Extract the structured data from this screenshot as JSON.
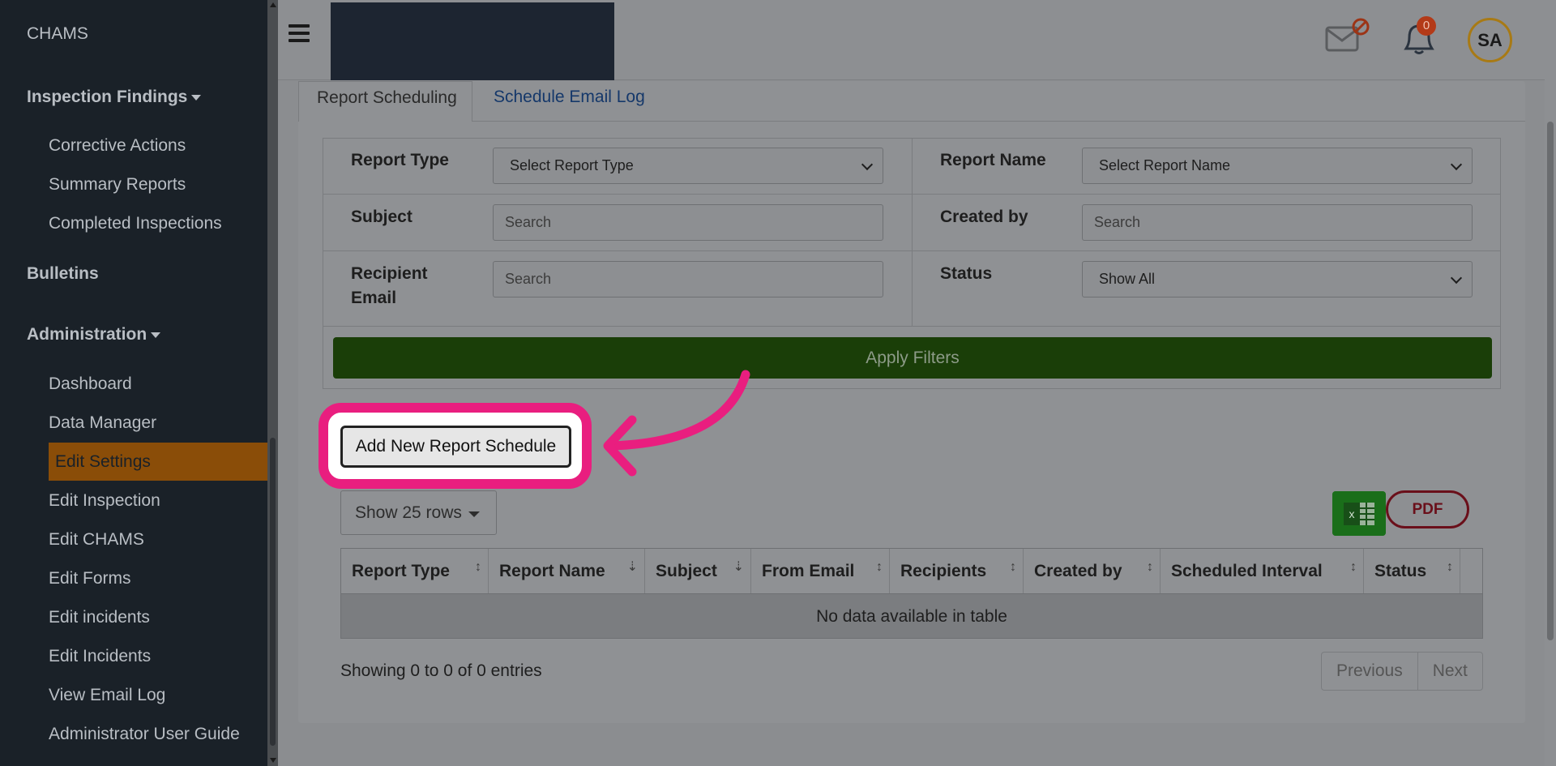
{
  "sidebar": {
    "brand": "CHAMS",
    "sections": [
      {
        "label": "Inspection Findings"
      },
      {
        "label": "Bulletins"
      },
      {
        "label": "Administration"
      }
    ],
    "inspection_items": [
      "Corrective Actions",
      "Summary Reports",
      "Completed Inspections"
    ],
    "admin_items": [
      "Dashboard",
      "Data Manager",
      "Edit Settings",
      "Edit Inspection",
      "Edit CHAMS",
      "Edit Forms",
      "Edit incidents",
      "Edit Incidents",
      "View Email Log",
      "Administrator User Guide"
    ]
  },
  "header": {
    "notification_count": "0",
    "avatar_initials": "SA"
  },
  "tabs": [
    "Report Scheduling",
    "Schedule Email Log"
  ],
  "filters": {
    "report_type_label": "Report Type",
    "report_type_value": "Select Report Type",
    "report_name_label": "Report Name",
    "report_name_value": "Select Report Name",
    "subject_label": "Subject",
    "subject_placeholder": "Search",
    "created_by_label": "Created by",
    "created_by_placeholder": "Search",
    "recipient_label_1": "Recipient",
    "recipient_label_2": "Email",
    "recipient_placeholder": "Search",
    "status_label": "Status",
    "status_value": "Show All",
    "apply_label": "Apply Filters"
  },
  "actions": {
    "add_label": "Add New Report Schedule",
    "rows_label": "Show 25 rows",
    "pdf_label": "PDF"
  },
  "table": {
    "columns": [
      "Report Type",
      "Report Name",
      "Subject",
      "From Email",
      "Recipients",
      "Created by",
      "Scheduled Interval",
      "Status"
    ],
    "empty_message": "No data available in table",
    "showing": "Showing 0 to 0 of 0 entries",
    "prev": "Previous",
    "next": "Next"
  },
  "colors": {
    "highlight": "#e91e7f",
    "apply": "#1a3e08",
    "active_item": "#8a4d08"
  }
}
